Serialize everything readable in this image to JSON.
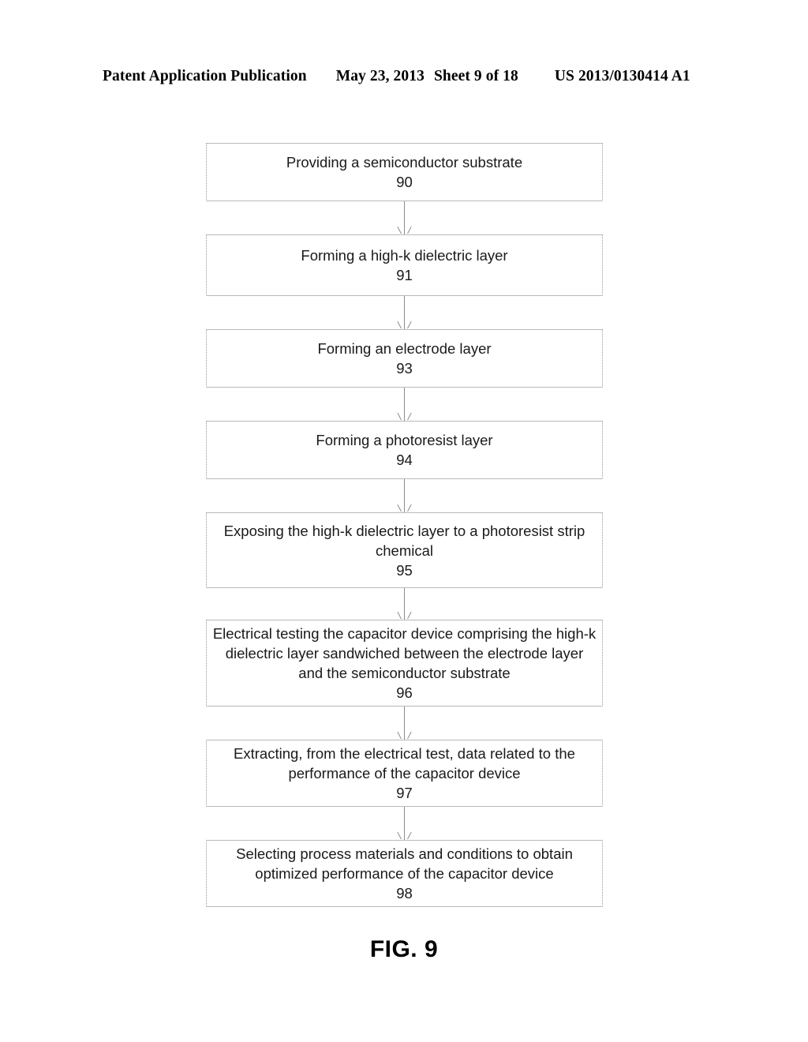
{
  "header": {
    "publication": "Patent Application Publication",
    "date": "May 23, 2013",
    "sheet": "Sheet 9 of 18",
    "publication_number": "US 2013/0130414 A1"
  },
  "figure": {
    "caption": "FIG. 9"
  },
  "flowchart": {
    "type": "flowchart",
    "orientation": "top-to-bottom",
    "connector": "arrow-down",
    "border_color": "#9a9a9a",
    "nodes": [
      {
        "label": "Providing a semiconductor substrate",
        "number": "90"
      },
      {
        "label": "Forming a high-k dielectric layer",
        "number": "91"
      },
      {
        "label": "Forming an electrode layer",
        "number": "93"
      },
      {
        "label": "Forming a photoresist layer",
        "number": "94"
      },
      {
        "label": "Exposing the high-k dielectric layer to a photoresist strip chemical",
        "number": "95"
      },
      {
        "label": "Electrical testing the capacitor device comprising the high-k dielectric layer sandwiched between the electrode layer and the semiconductor substrate",
        "number": "96"
      },
      {
        "label": "Extracting, from the electrical test, data related to the performance of the capacitor device",
        "number": "97"
      },
      {
        "label": "Selecting process materials and conditions to obtain optimized performance of the capacitor device",
        "number": "98"
      }
    ]
  }
}
